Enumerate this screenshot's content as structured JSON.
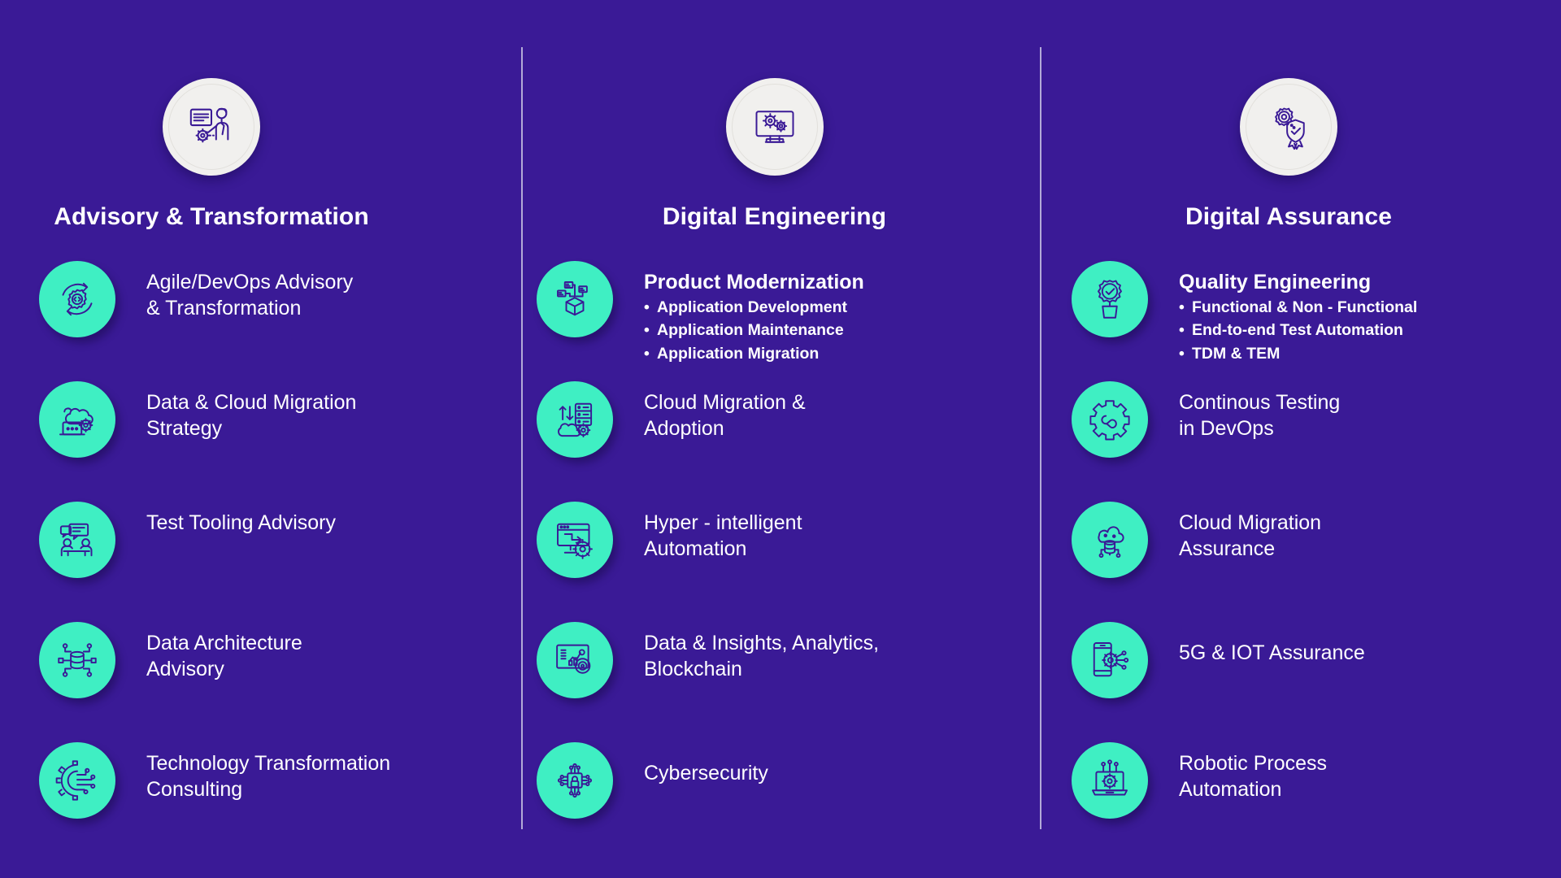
{
  "theme": {
    "background": "#3A1A96",
    "accent_teal": "#3FEFC3",
    "header_circle": "#F1F0EE",
    "text": "#FFFFFF",
    "divider": "#C9C4E4",
    "icon_stroke": "#3A1A96"
  },
  "columns": [
    {
      "title": "Advisory & Transformation",
      "header_icon": "presentation-advisor-icon",
      "items": [
        {
          "icon": "agile-devops-cycle-icon",
          "lines": [
            "Agile/DevOps Advisory",
            "& Transformation"
          ],
          "bullets": []
        },
        {
          "icon": "cloud-laptop-gear-icon",
          "lines": [
            "Data & Cloud Migration",
            "Strategy"
          ],
          "bullets": []
        },
        {
          "icon": "people-chat-table-icon",
          "lines": [
            "Test Tooling Advisory"
          ],
          "bullets": []
        },
        {
          "icon": "data-architecture-node-icon",
          "lines": [
            "Data Architecture",
            "Advisory"
          ],
          "bullets": []
        },
        {
          "icon": "gear-circuit-icon",
          "lines": [
            "Technology Transformation",
            "Consulting"
          ],
          "bullets": []
        }
      ]
    },
    {
      "title": "Digital Engineering",
      "header_icon": "monitor-gears-icon",
      "items": [
        {
          "icon": "product-package-network-icon",
          "lines": [
            "Product Modernization"
          ],
          "bold": true,
          "bullets": [
            "Application Development",
            "Application Maintenance",
            "Application Migration"
          ]
        },
        {
          "icon": "cloud-server-transfer-icon",
          "lines": [
            "Cloud Migration &",
            "Adoption"
          ],
          "bullets": []
        },
        {
          "icon": "monitor-automation-gear-icon",
          "lines": [
            "Hyper - intelligent",
            "Automation"
          ],
          "bullets": []
        },
        {
          "icon": "analytics-chart-icon",
          "lines": [
            "Data & Insights, Analytics,",
            "Blockchain"
          ],
          "bullets": []
        },
        {
          "icon": "cybersecurity-lock-chip-icon",
          "lines": [
            "Cybersecurity"
          ],
          "bullets": []
        }
      ]
    },
    {
      "title": "Digital Assurance",
      "header_icon": "gear-shield-badge-icon",
      "items": [
        {
          "icon": "gear-check-icon",
          "lines": [
            "Quality Engineering"
          ],
          "bold": true,
          "bullets": [
            "Functional & Non - Functional",
            "End-to-end Test Automation",
            "TDM & TEM"
          ]
        },
        {
          "icon": "gear-infinity-icon",
          "lines": [
            "Continous Testing",
            "in DevOps"
          ],
          "bullets": []
        },
        {
          "icon": "cloud-database-icon",
          "lines": [
            "Cloud Migration",
            "Assurance"
          ],
          "bullets": []
        },
        {
          "icon": "mobile-gear-network-icon",
          "lines": [
            "5G & IOT Assurance"
          ],
          "bullets": []
        },
        {
          "icon": "laptop-gear-robot-icon",
          "lines": [
            "Robotic Process",
            "Automation"
          ],
          "bullets": []
        }
      ]
    }
  ],
  "bullet_glyph": "•"
}
